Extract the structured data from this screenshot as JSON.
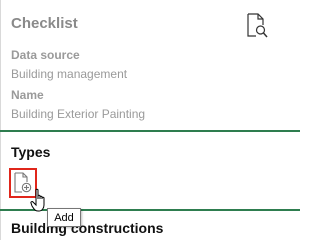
{
  "header": {
    "title": "Checklist",
    "preview_icon": "document-search-icon"
  },
  "fields": {
    "data_source": {
      "label": "Data source",
      "value": "Building management"
    },
    "name": {
      "label": "Name",
      "value": "Building Exterior Painting"
    }
  },
  "sections": {
    "types": {
      "title": "Types",
      "add_icon": "add-document-icon"
    },
    "constructions": {
      "title": "Building constructions"
    }
  },
  "tooltip": {
    "text": "Add"
  },
  "colors": {
    "divider": "#2e7d4f",
    "highlight": "#e0261b",
    "muted_text": "#9a9a9a"
  }
}
